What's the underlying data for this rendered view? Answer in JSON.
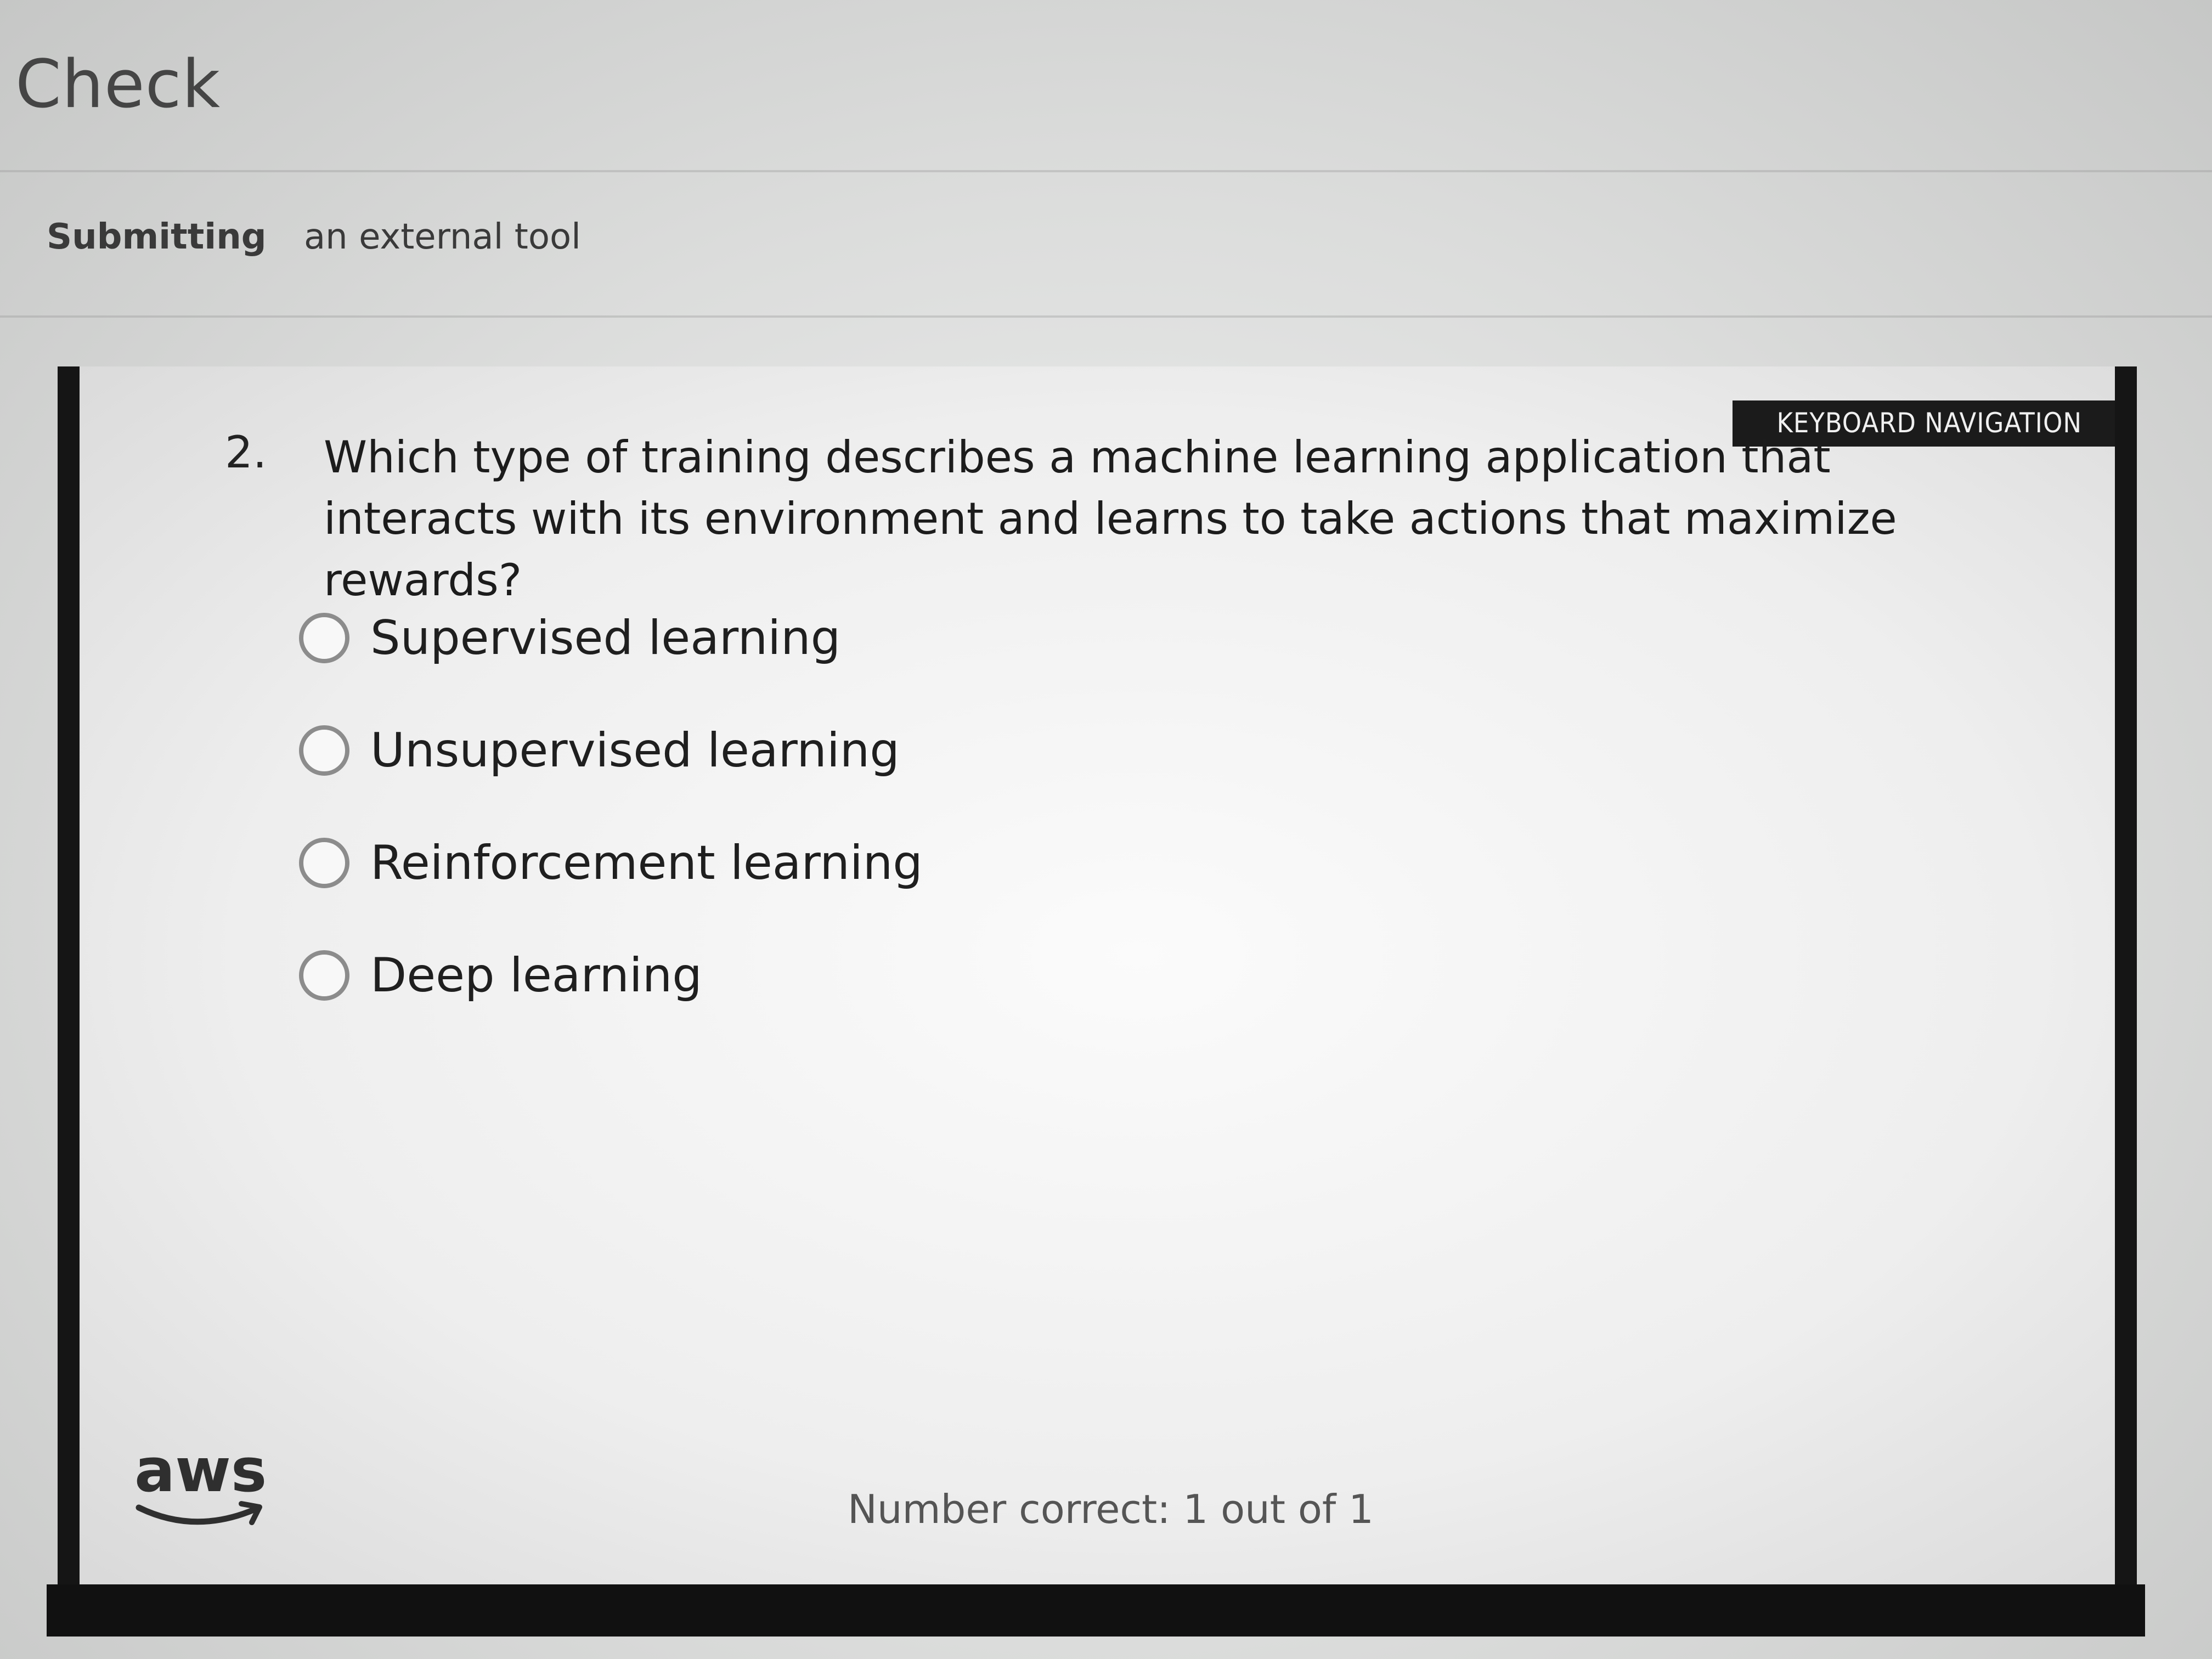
{
  "header": {
    "title": "Check",
    "submitting_label": "Submitting",
    "submitting_value": "an external tool"
  },
  "quiz": {
    "keyboard_navigation_label": "KEYBOARD NAVIGATION",
    "question_number": "2.",
    "question_text": "Which type of training describes a machine learning application that interacts with its environment and learns to take actions that maximize rewards?",
    "options": [
      {
        "label": "Supervised learning"
      },
      {
        "label": "Unsupervised learning"
      },
      {
        "label": "Reinforcement learning"
      },
      {
        "label": "Deep learning"
      }
    ],
    "score_text": "Number correct: 1 out of 1",
    "logo": "aws"
  }
}
